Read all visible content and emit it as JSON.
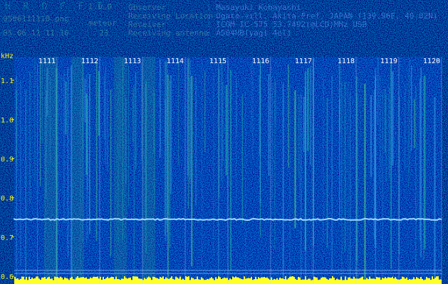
{
  "app": {
    "name": "H R O F F T",
    "version": "1.0.0"
  },
  "file": {
    "name": "0506111110.png",
    "datetime": "05.06.11 11:10"
  },
  "meteor": {
    "label": "meteor",
    "count": "23"
  },
  "station": {
    "observer_label": "Observer",
    "observer": ": Masayuki Kobayashi",
    "location_label": "Receiving Location",
    "location": ": Ogata-vill. Akita-Pref. JAPAN (139.96E, 40.02N)",
    "receiver_label": "Receiver",
    "receiver": ": ICOM IC-575 53.7492(@LCD)MHz USB",
    "antenna_label": "Receiving antenna",
    "antenna": ": A504HB(yagi 4el)"
  },
  "y_axis": {
    "unit": "kHz",
    "ticks": [
      "1.1",
      "1.0",
      "0.9",
      "0.8",
      "0.7",
      "0.6"
    ]
  },
  "x_axis": {
    "ticks": [
      "1111",
      "1112",
      "1113",
      "1114",
      "1115",
      "1116",
      "1117",
      "1118",
      "1119",
      "1120"
    ]
  },
  "colors": {
    "text_green": "#2ee62e",
    "text_yellow": "#f2f21e",
    "signal_line": "#9fd8ff",
    "amplitude_strip": "#ffff28"
  }
}
